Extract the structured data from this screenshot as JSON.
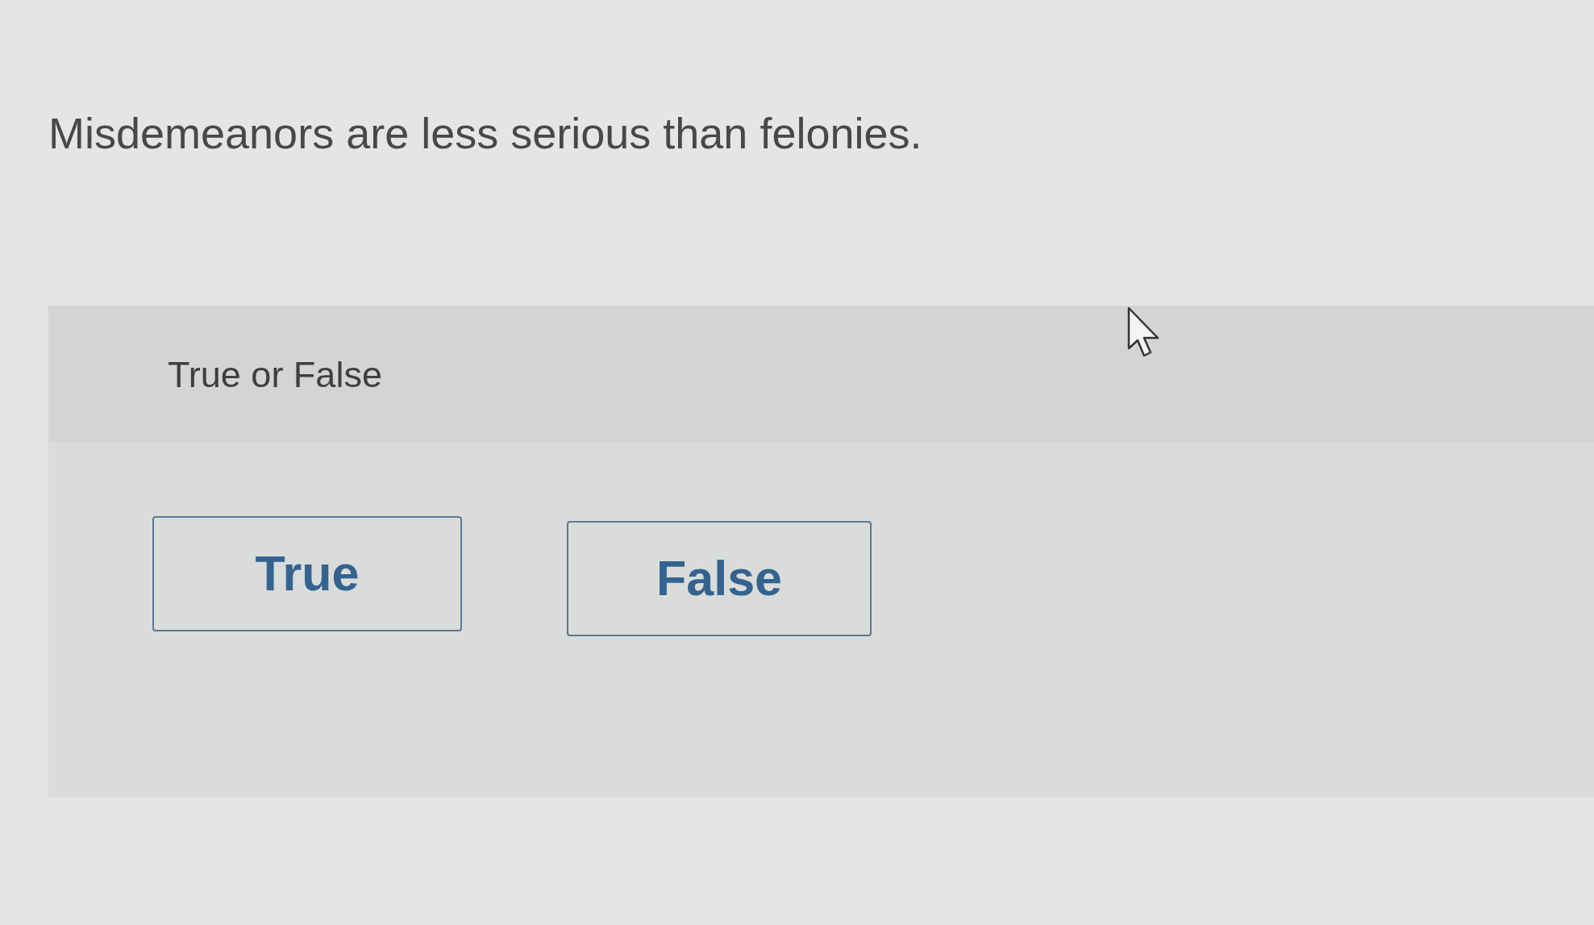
{
  "question": {
    "text": "Misdemeanors are less serious than felonies."
  },
  "answer_panel": {
    "prompt": "True or False",
    "options": [
      {
        "label": "True",
        "selected": false
      },
      {
        "label": "False",
        "selected": false
      }
    ]
  }
}
